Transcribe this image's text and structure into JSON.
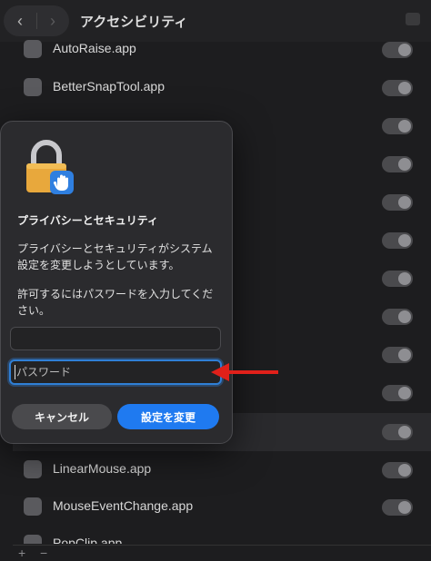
{
  "window": {
    "title": "アクセシビリティ"
  },
  "apps": [
    {
      "name": "AutoRaise.app"
    },
    {
      "name": "BetterSnapTool.app"
    },
    {
      "name": ""
    },
    {
      "name": ""
    },
    {
      "name": ""
    },
    {
      "name": ""
    },
    {
      "name": ""
    },
    {
      "name": ""
    },
    {
      "name": ""
    },
    {
      "name": ""
    },
    {
      "name": ""
    },
    {
      "name": "LinearMouse.app"
    },
    {
      "name": "MouseEventChange.app"
    },
    {
      "name": "PopClip.app"
    }
  ],
  "bottom_bar": {
    "add": "+",
    "remove": "−"
  },
  "dialog": {
    "title": "プライバシーとセキュリティ",
    "message": "プライバシーとセキュリティがシステム設定を変更しようとしています。",
    "prompt": "許可するにはパスワードを入力してください。",
    "username_value": "",
    "password_placeholder": "パスワード",
    "cancel_label": "キャンセル",
    "confirm_label": "設定を変更"
  },
  "colors": {
    "accent": "#1f7af0",
    "focus_ring": "#2f7fd6",
    "annotation_arrow": "#e0201a"
  }
}
